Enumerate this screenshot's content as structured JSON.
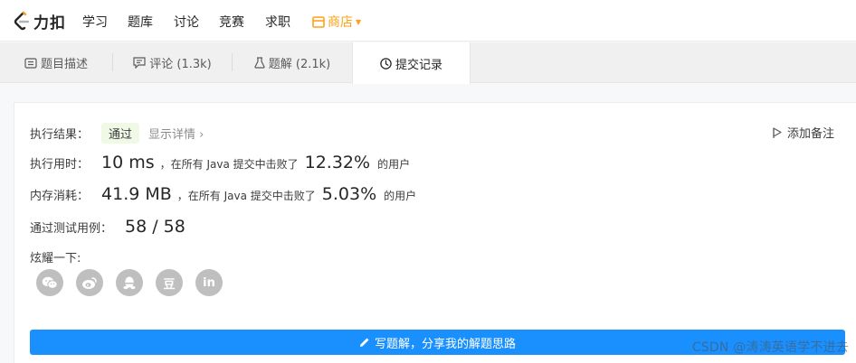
{
  "nav": {
    "logo_text": "力扣",
    "items": [
      "学习",
      "题库",
      "讨论",
      "竞赛",
      "求职"
    ],
    "store": "商店"
  },
  "tabs": [
    {
      "label": "题目描述"
    },
    {
      "label": "评论 (1.3k)"
    },
    {
      "label": "题解 (2.1k)"
    },
    {
      "label": "提交记录"
    }
  ],
  "result": {
    "label": "执行结果：",
    "status": "通过",
    "detail": "显示详情 ›",
    "add_note": "添加备注"
  },
  "runtime": {
    "label": "执行用时：",
    "value": "10 ms",
    "text": "，在所有 Java 提交中击败了",
    "percent": "12.32%",
    "suffix": "的用户"
  },
  "memory": {
    "label": "内存消耗：",
    "value": "41.9 MB",
    "text": "，在所有 Java 提交中击败了",
    "percent": "5.03%",
    "suffix": "的用户"
  },
  "tests": {
    "label": "通过测试用例：",
    "value": "58 / 58"
  },
  "share": {
    "label": "炫耀一下:",
    "icons": [
      "wechat-icon",
      "weibo-icon",
      "qq-icon",
      "douban-icon",
      "linkedin-icon"
    ],
    "douban_glyph": "豆",
    "linkedin_glyph": "in"
  },
  "cta": "写题解，分享我的解题思路",
  "watermark": "CSDN @涛涛英语学不进去",
  "colors": {
    "accent": "#ffa116",
    "primary_button": "#1a90ff",
    "pass_badge_bg": "#f0f9e6"
  }
}
